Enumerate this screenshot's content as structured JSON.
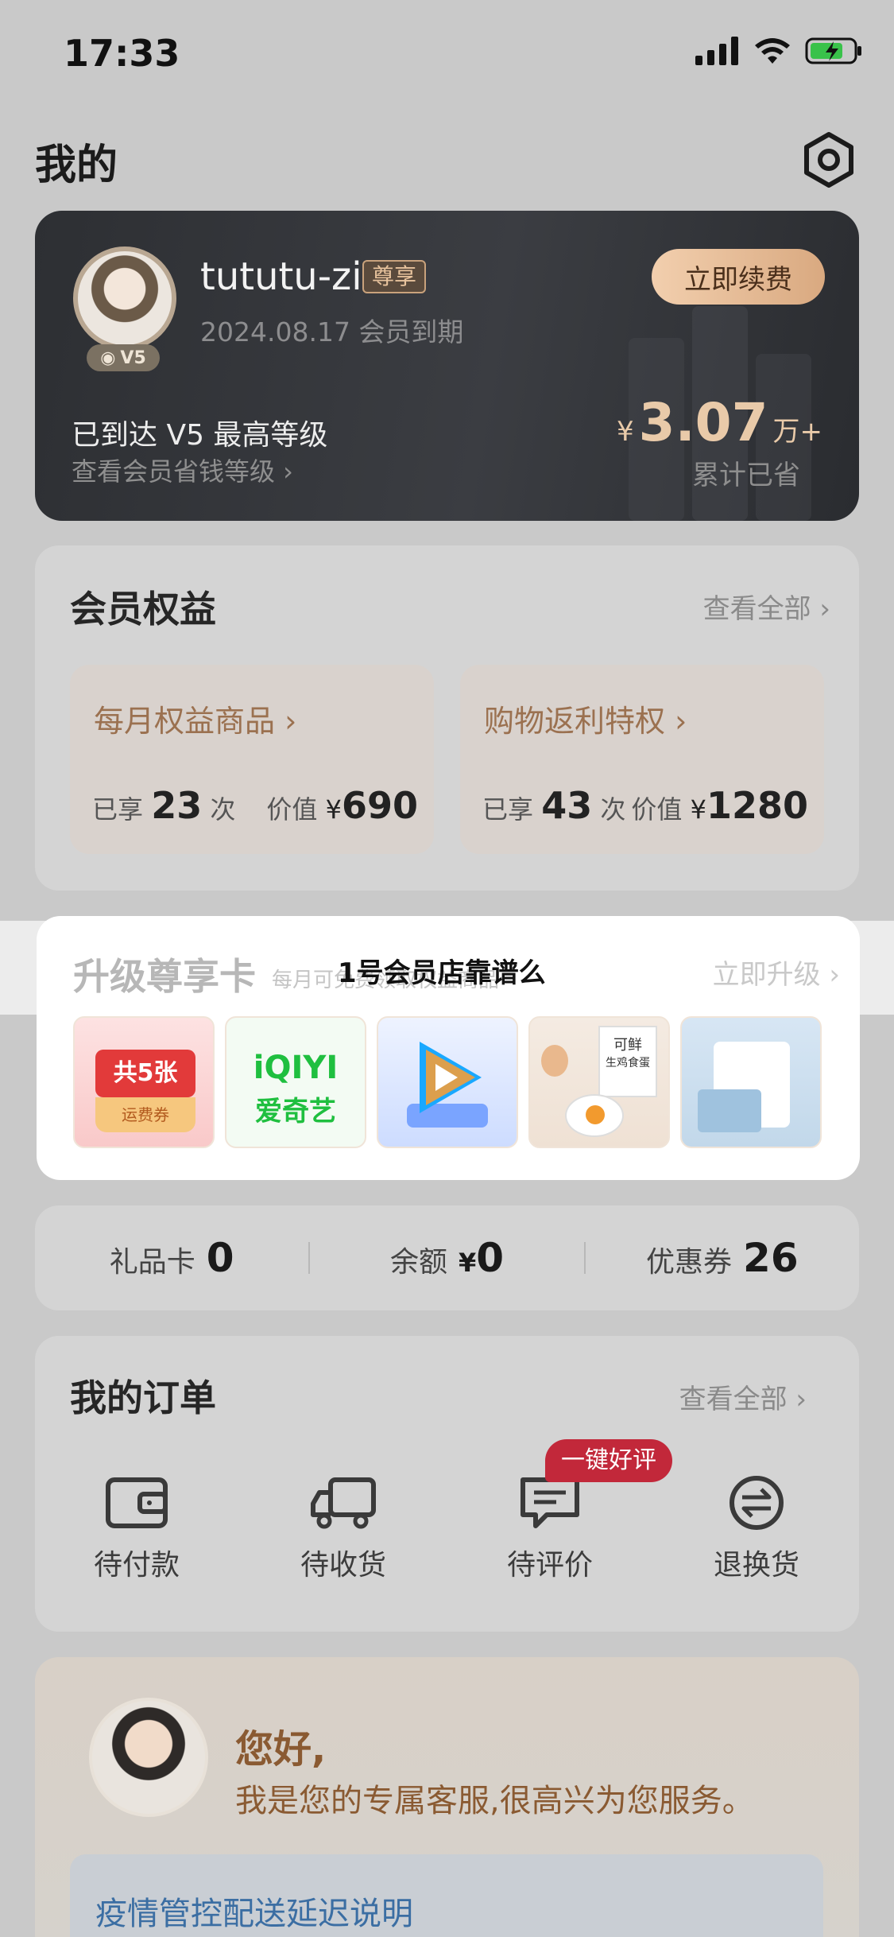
{
  "status": {
    "time": "17:33"
  },
  "header": {
    "title": "我的",
    "settings_icon": "hexagon-gear-icon"
  },
  "member": {
    "username": "tututu-zi",
    "vip_tag": "尊享",
    "level_badge": "V5",
    "expire": "2024.08.17 会员到期",
    "renew_label": "立即续费",
    "level_text": "已到达 V5 最高等级",
    "level_link": "查看会员省钱等级 ›",
    "saved_currency": "¥",
    "saved_amount": "3.07",
    "saved_unit": "万+",
    "saved_label": "累计已省"
  },
  "benefits": {
    "title": "会员权益",
    "view_all": "查看全部 ›",
    "items": [
      {
        "title": "每月权益商品 ›",
        "used_prefix": "已享",
        "used": "23",
        "used_suffix": "次",
        "value_prefix": "价值",
        "currency": "¥",
        "value": "690"
      },
      {
        "title": "购物返利特权 ›",
        "used_prefix": "已享",
        "used": "43",
        "used_suffix": "次",
        "value_prefix": "价值",
        "currency": "¥",
        "value": "1280"
      }
    ]
  },
  "upgrade": {
    "title": "升级尊享卡",
    "subtitle": "每月可免费领取权益商品",
    "link": "立即升级 ›",
    "overlay": "1号会员店靠谱么",
    "thumbs": [
      {
        "icon": "coupon-icon",
        "line1": "共5张",
        "line2": "运费券"
      },
      {
        "icon": "iqiyi-logo",
        "line1": "iQIYI",
        "line2": "爱奇艺"
      },
      {
        "icon": "play-logo-icon"
      },
      {
        "icon": "eggs-product-image",
        "line1": "可鲜",
        "line2": "生鸡食蛋"
      },
      {
        "icon": "product-package-image"
      }
    ]
  },
  "assets": [
    {
      "label": "礼品卡",
      "prefix": "",
      "value": "0"
    },
    {
      "label": "余额",
      "prefix": "¥",
      "value": "0"
    },
    {
      "label": "优惠券",
      "prefix": "",
      "value": "26"
    }
  ],
  "orders": {
    "title": "我的订单",
    "view_all": "查看全部 ›",
    "badge": "一键好评",
    "items": [
      {
        "label": "待付款",
        "icon": "wallet-icon"
      },
      {
        "label": "待收货",
        "icon": "truck-icon"
      },
      {
        "label": "待评价",
        "icon": "comment-icon"
      },
      {
        "label": "退换货",
        "icon": "exchange-icon"
      }
    ]
  },
  "service": {
    "hello": "您好,",
    "desc": "我是您的专属客服,很高兴为您服务。",
    "notice": "疫情管控配送延迟说明"
  }
}
